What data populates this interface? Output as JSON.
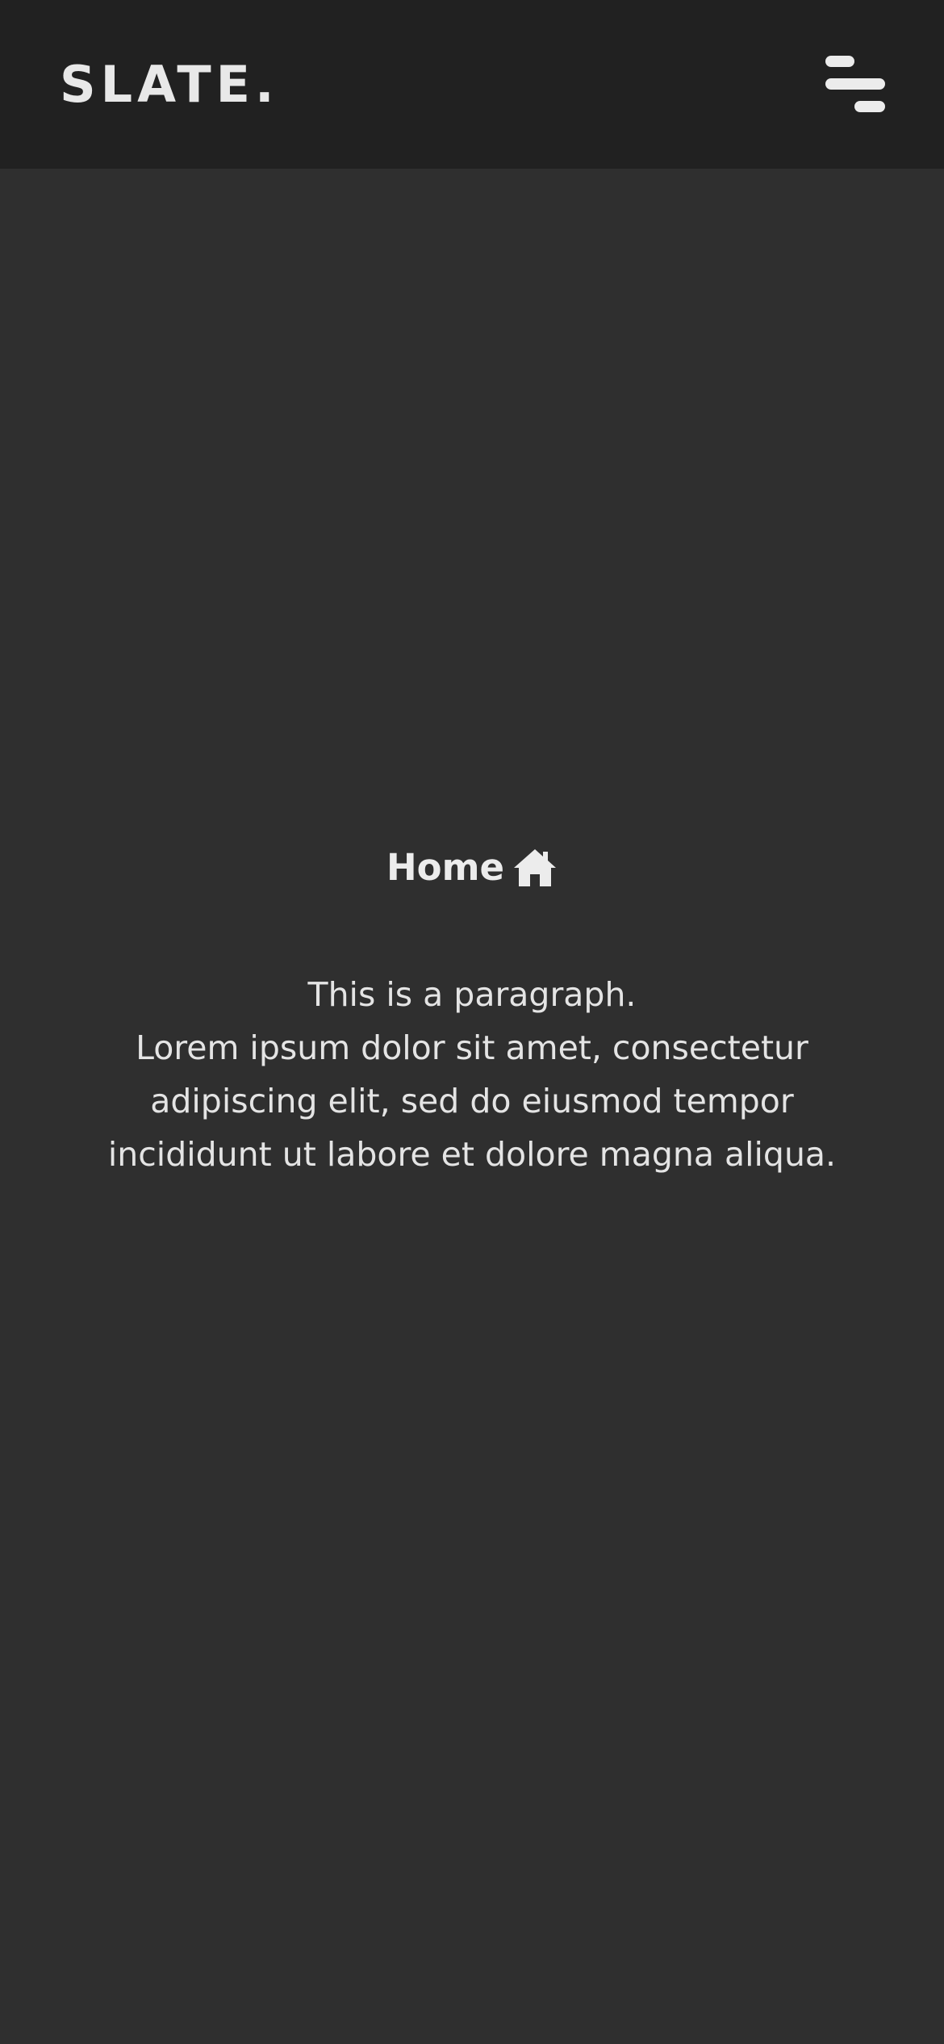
{
  "header": {
    "logo": "SLATE.",
    "menu_icon": "hamburger-menu-icon"
  },
  "main": {
    "title": "Home",
    "title_icon": "home-icon",
    "paragraph": {
      "line1": "This is a paragraph.",
      "line2": "Lorem ipsum dolor sit amet, consectetur adipiscing elit, sed do eiusmod tempor incididunt ut labore et dolore magna aliqua."
    }
  },
  "colors": {
    "header_bg": "#212121",
    "page_bg": "#2f2f2f",
    "text": "#e7e7e7"
  }
}
